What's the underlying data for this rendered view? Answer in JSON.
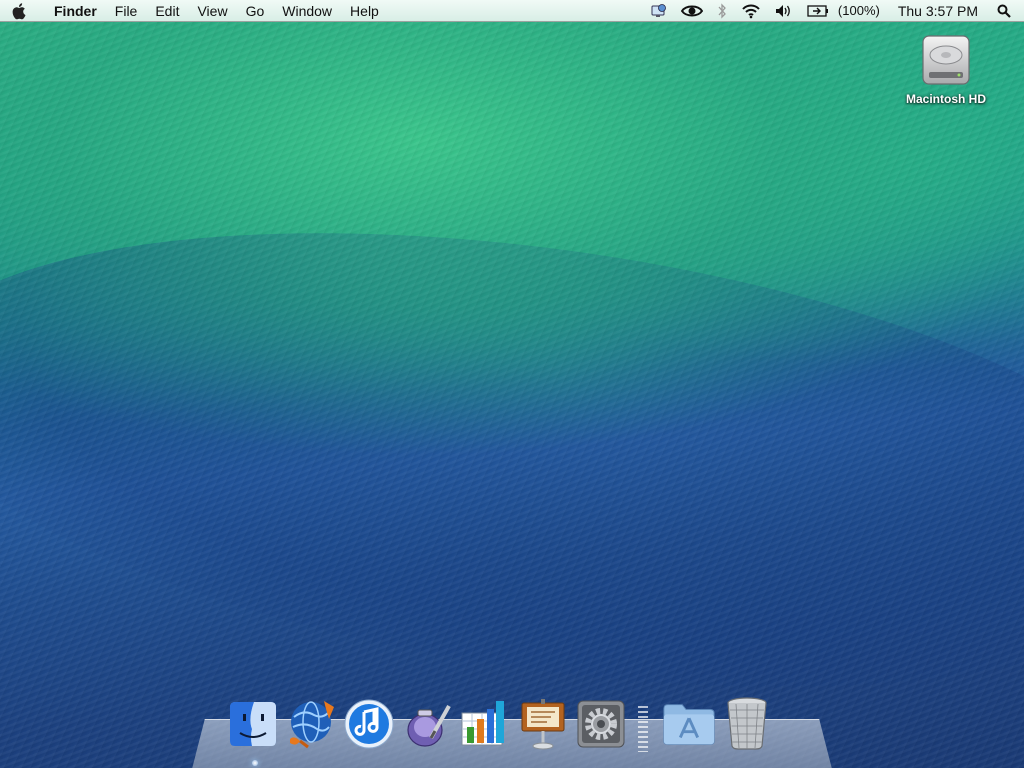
{
  "menubar": {
    "apple_icon": "apple-logo-icon",
    "items": [
      {
        "label": "Finder"
      },
      {
        "label": "File"
      },
      {
        "label": "Edit"
      },
      {
        "label": "View"
      },
      {
        "label": "Go"
      },
      {
        "label": "Window"
      },
      {
        "label": "Help"
      }
    ],
    "status": {
      "battery_percent": "(100%)",
      "clock": "Thu 3:57 PM"
    }
  },
  "desktop": {
    "icons": [
      {
        "label": "Macintosh HD",
        "icon": "hard-drive-icon"
      }
    ]
  },
  "dock": {
    "apps": [
      {
        "icon": "finder-icon"
      },
      {
        "icon": "network-utility-icon"
      },
      {
        "icon": "itunes-icon"
      },
      {
        "icon": "script-editor-icon"
      },
      {
        "icon": "numbers-icon"
      },
      {
        "icon": "keynote-icon"
      },
      {
        "icon": "system-preferences-icon"
      }
    ],
    "folders": [
      {
        "icon": "applications-folder-icon"
      },
      {
        "icon": "trash-icon"
      }
    ]
  }
}
